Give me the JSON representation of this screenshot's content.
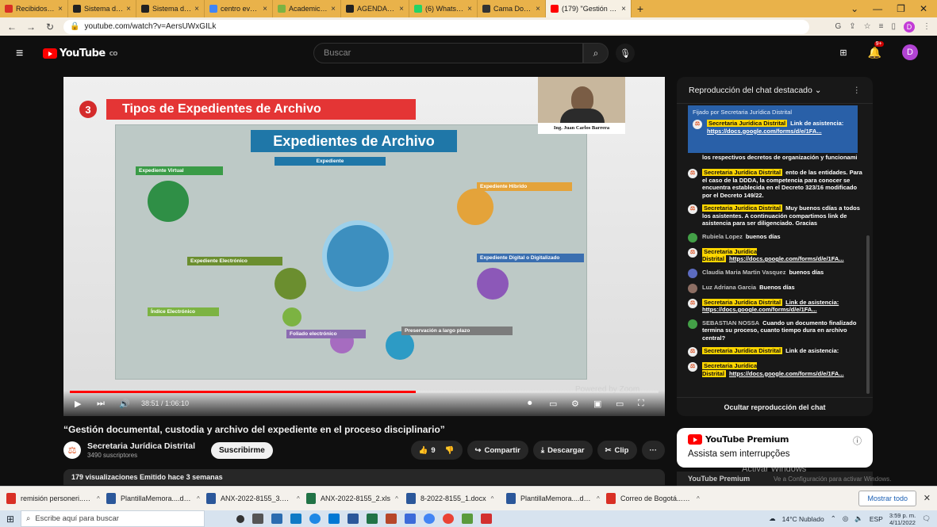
{
  "browser": {
    "tabs": [
      {
        "label": "Recibidos (1157) - dy",
        "color": "#d93025"
      },
      {
        "label": "Sistema de Gestión D",
        "color": "#222"
      },
      {
        "label": "Sistema de Gestión D",
        "color": "#222"
      },
      {
        "label": "centro eventos valle",
        "color": "#4285f4"
      },
      {
        "label": "Academica | Cannabis",
        "color": "#7cb342"
      },
      {
        "label": "AGENDAS-HORIZONT",
        "color": "#222"
      },
      {
        "label": "(6) WhatsApp",
        "color": "#25d366"
      },
      {
        "label": "Cama Dokka Acento",
        "color": "#333"
      },
      {
        "label": "(179) \"Gestión docum",
        "color": "#ff0000"
      }
    ],
    "new_tab": "+",
    "url": "youtube.com/watch?v=AersUWxGILk",
    "profile_initial": "D"
  },
  "youtube": {
    "logo": "YouTube",
    "country": "CO",
    "search_placeholder": "Buscar",
    "notif_badge": "9+",
    "avatar_initial": "D"
  },
  "video": {
    "slide_number": "3",
    "slide_title": "Tipos de Expedientes de Archivo",
    "infographic_title": "Expedientes de Archivo",
    "boxes": [
      {
        "label": "Expediente Virtual",
        "color": "#3a9b47"
      },
      {
        "label": "Expediente",
        "color": "#1f77a8"
      },
      {
        "label": "Expediente Híbrido",
        "color": "#e4a33a"
      },
      {
        "label": "Expediente Electrónico",
        "color": "#6b8e2f"
      },
      {
        "label": "Expediente Digital o Digitalizado",
        "color": "#3b6fb0"
      },
      {
        "label": "Índice Electrónico",
        "color": "#7cb342"
      },
      {
        "label": "Foliado electrónico",
        "color": "#8c6bb1"
      },
      {
        "label": "Preservación a largo plazo",
        "color": "#7c7c7c"
      }
    ],
    "presenter_name": "Ing. Juan Carlos Barrera",
    "watermark": "Powered by Zoom",
    "time": "38:51 / 1:06:10",
    "progress": 0.587,
    "title": "“Gestión documental, custodia y archivo del expediente en el proceso disciplinario”"
  },
  "channel": {
    "name": "Secretaria Jurídica Distrital",
    "subs": "3490 suscriptores",
    "subscribe": "Suscribirme",
    "likes": "9",
    "share": "Compartir",
    "download": "Descargar",
    "clip": "Clip",
    "more": "···",
    "stats": "179 visualizaciones  Emitido hace 3 semanas"
  },
  "chat": {
    "header": "Reproducción del chat destacado",
    "pinned_label": "Fijado por Secretaria Jurídica Distrital",
    "pinned_author": "Secretaria Jurídica Distrital",
    "pinned_text": "Link de asistencia:",
    "pinned_link": "https://docs.google.com/forms/d/e/1FA...",
    "footer": "Ocultar reproducción del chat",
    "messages": [
      {
        "author": "",
        "text": "los respectivos decretos de organización y funcionami",
        "owner": false
      },
      {
        "author": "Secretaria Jurídica Distrital",
        "text": "ento de las entidades. Para el caso de la DDDA, la competencia para conocer se encuentra establecida en el Decreto 323/16 modificado por el Decreto 149/22.",
        "owner": true
      },
      {
        "author": "Secretaria Jurídica Distrital",
        "text": "Muy buenos cdías a todos los asistentes. A continuación compartimos link de asistencia para ser diligenciado. Gracias",
        "owner": true
      },
      {
        "author": "Rubiela Lopez",
        "text": "buenos días",
        "owner": false
      },
      {
        "author": "Secretaria Jurídica Distrital",
        "text": "https://docs.google.com/forms/d/e/1FA...",
        "owner": true
      },
      {
        "author": "Claudia Maria Martin Vasquez",
        "text": "buenos días",
        "owner": false
      },
      {
        "author": "Luz Adriana Garcia",
        "text": "Buenos días",
        "owner": false
      },
      {
        "author": "Secretaria Jurídica Distrital",
        "text": "Link de asistencia: https://docs.google.com/forms/d/e/1FA...",
        "owner": true
      },
      {
        "author": "SEBASTIAN NOSSA",
        "text": "Cuando un documento finalizado termina su proceso, cuanto tiempo dura en archivo central?",
        "owner": false
      },
      {
        "author": "Secretaria Jurídica Distrital",
        "text": "Link de asistencia:",
        "owner": true
      },
      {
        "author": "Secretaria Jurídica Distrital",
        "text": "https://docs.google.com/forms/d/e/1FA...",
        "owner": true
      }
    ]
  },
  "premium": {
    "logo": "YouTube Premium",
    "subtitle": "Assista sem interrupções",
    "next": "YouTube Premium",
    "activate": "Activar Windows",
    "activate_sub": "Ve a Configuración para activar Windows."
  },
  "downloads": {
    "items": [
      {
        "name": "remisión personeri....pdf",
        "color": "#d93025"
      },
      {
        "name": "PlantillaMemora....docx",
        "color": "#2b579a"
      },
      {
        "name": "ANX-2022-8155_3.doc",
        "color": "#2b579a"
      },
      {
        "name": "ANX-2022-8155_2.xls",
        "color": "#217346"
      },
      {
        "name": "8-2022-8155_1.docx",
        "color": "#2b579a"
      },
      {
        "name": "PlantillaMemora....docx",
        "color": "#2b579a"
      },
      {
        "name": "Correo de Bogotá....pdf",
        "color": "#d93025"
      }
    ],
    "show_all": "Mostrar todo"
  },
  "taskbar": {
    "search": "Escribe aquí para buscar",
    "weather": "14°C  Nublado",
    "lang": "ESP",
    "time": "3:59 p. m.",
    "date": "4/11/2022"
  }
}
